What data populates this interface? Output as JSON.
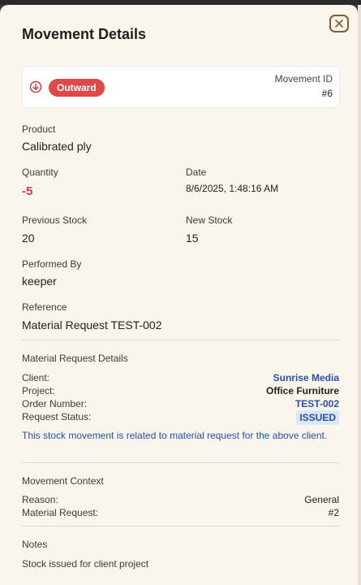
{
  "modal": {
    "title": "Movement Details"
  },
  "header": {
    "direction_badge": "Outward",
    "movement_id_label": "Movement ID",
    "movement_id": "#6",
    "colors": {
      "badge": "#e04848",
      "icon": "#d63b3b"
    },
    "icon": "arrow-down-circle-icon"
  },
  "fields": {
    "product_label": "Product",
    "product": "Calibrated ply",
    "quantity_label": "Quantity",
    "quantity": "-5",
    "date_label": "Date",
    "date": "8/6/2025, 1:48:16 AM",
    "previous_stock_label": "Previous Stock",
    "previous_stock": "20",
    "new_stock_label": "New Stock",
    "new_stock": "15",
    "performed_by_label": "Performed By",
    "performed_by": "keeper",
    "reference_label": "Reference",
    "reference": "Material Request TEST-002"
  },
  "material_request": {
    "section_title": "Material Request Details",
    "client_label": "Client:",
    "client": "Sunrise Media",
    "project_label": "Project:",
    "project": "Office Furniture",
    "order_number_label": "Order Number:",
    "order_number": "TEST-002",
    "request_status_label": "Request Status:",
    "request_status": "ISSUED",
    "note": "This stock movement is related to material request for the above client."
  },
  "movement_context": {
    "section_title": "Movement Context",
    "reason_label": "Reason:",
    "reason": "General",
    "material_request_label": "Material Request:",
    "material_request": "#2"
  },
  "notes": {
    "section_title": "Notes",
    "text": "Stock issued for client project"
  }
}
